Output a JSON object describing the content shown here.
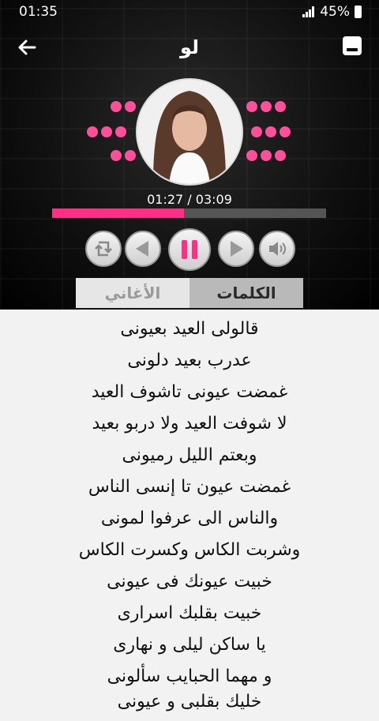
{
  "status": {
    "time": "01:35",
    "battery": "45%"
  },
  "appbar": {
    "title": "لو"
  },
  "player": {
    "time_display": "01:27 / 03:09",
    "progress": 0.48
  },
  "tabs": {
    "lyrics": "الكلمات",
    "songs": "الأغاني"
  },
  "lyrics": [
    "قالولى العيد بعيونى",
    "عدرب بعيد دلونى",
    "غمضت عيونى تاشوف العيد",
    "لا شوفت العيد ولا دربو بعيد",
    "وبعتم الليل رميونى",
    "غمضت عيون تا إنسى الناس",
    "والناس الى عرفوا لمونى",
    "وشربت الكاس وكسرت الكاس",
    "خبيت عيونك فى عيونى",
    "خبيت بقلبك اسرارى",
    "يا ساكن ليلى و نهارى",
    "و مهما الحبايب سألونى",
    "خليك بقلبى و عيونى"
  ],
  "colors": {
    "accent": "#ff2f86",
    "dots": "#ff4f9a"
  },
  "icons": [
    "back-arrow-icon",
    "menu-icon",
    "repeat-icon",
    "previous-icon",
    "pause-icon",
    "next-icon",
    "volume-icon"
  ]
}
